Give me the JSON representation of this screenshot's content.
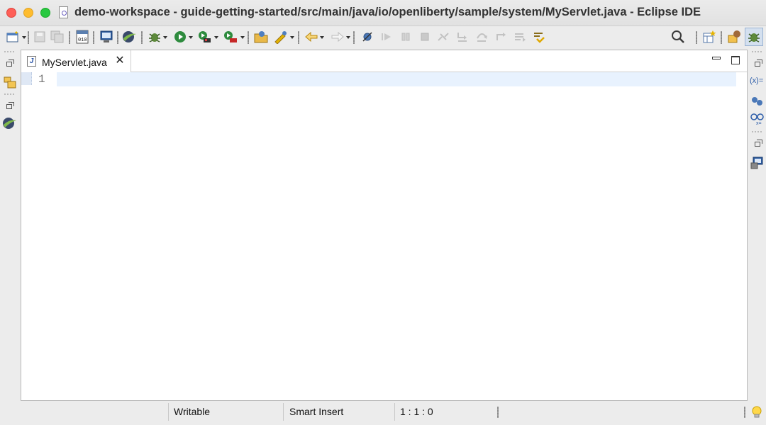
{
  "window": {
    "title": "demo-workspace - guide-getting-started/src/main/java/io/openliberty/sample/system/MyServlet.java - Eclipse IDE"
  },
  "toolbar": {
    "items": [
      "new-icon",
      "save-icon",
      "save-all-icon",
      "binary-010-icon",
      "terminal-icon",
      "eclipse-icon",
      "debug-icon",
      "run-icon",
      "run-configurations-icon",
      "external-tools-icon",
      "open-type-icon",
      "open-task-icon",
      "back-icon",
      "forward-icon",
      "skip-breakpoints-icon",
      "resume-icon",
      "suspend-icon",
      "terminate-icon",
      "disconnect-icon",
      "step-into-icon",
      "step-over-icon",
      "step-return-icon",
      "drop-to-frame-icon",
      "use-step-filters-icon",
      "search-icon",
      "open-perspective-icon",
      "java-perspective-icon",
      "debug-perspective-icon"
    ],
    "binary_label": "010"
  },
  "editor": {
    "tab_label": "MyServlet.java",
    "tab_icon_letter": "J",
    "close_glyph": "✕",
    "line_numbers": [
      "1"
    ]
  },
  "right_trim": {
    "variables_label": "(x)="
  },
  "status": {
    "writable": "Writable",
    "insert_mode": "Smart Insert",
    "position": "1 : 1 : 0"
  },
  "colors": {
    "current_line": "#e8f2fe",
    "close": "#fe5f57",
    "minimize": "#febc2e",
    "maximize": "#28c840"
  }
}
